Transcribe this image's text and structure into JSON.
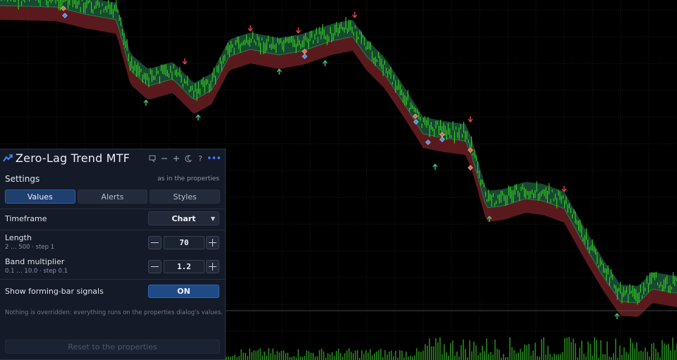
{
  "chart": {
    "colors": {
      "background": "#000000",
      "grid": "#2a2a2a",
      "price": "#35e01c",
      "band_upper": "#1d5a3c",
      "band_lower": "#6a1f22",
      "up_arrow": "#3fc77a",
      "down_arrow": "#e6474a",
      "volume": "#1f6d16"
    },
    "icons": [
      "arrow-up-icon",
      "arrow-down-icon",
      "diamond-marker-icon"
    ]
  },
  "panel": {
    "title": "Zero-Lag Trend MTF",
    "icons": [
      "chart-toggle-icon",
      "minimize-icon",
      "plus-icon",
      "moon-icon",
      "help-icon",
      "more-icon"
    ],
    "help_label": "?",
    "more_label": "•••",
    "section_title": "Settings",
    "section_note": "as in the properties",
    "tabs": [
      {
        "label": "Values",
        "active": true
      },
      {
        "label": "Alerts",
        "active": false
      },
      {
        "label": "Styles",
        "active": false
      }
    ],
    "timeframe": {
      "label": "Timeframe",
      "value": "Chart"
    },
    "length": {
      "label": "Length",
      "range": "2 … 500  ·  step 1",
      "value": "70"
    },
    "band_multiplier": {
      "label": "Band multiplier",
      "range": "0.1 … 10.0  ·  step 0.1",
      "value": "1.2"
    },
    "forming_bar": {
      "label": "Show forming-bar signals",
      "value": "ON"
    },
    "info_text": "Nothing is overridden: everything runs on the properties dialog's values.",
    "reset_label": "Reset to the properties",
    "accent": "#2e68b8"
  }
}
